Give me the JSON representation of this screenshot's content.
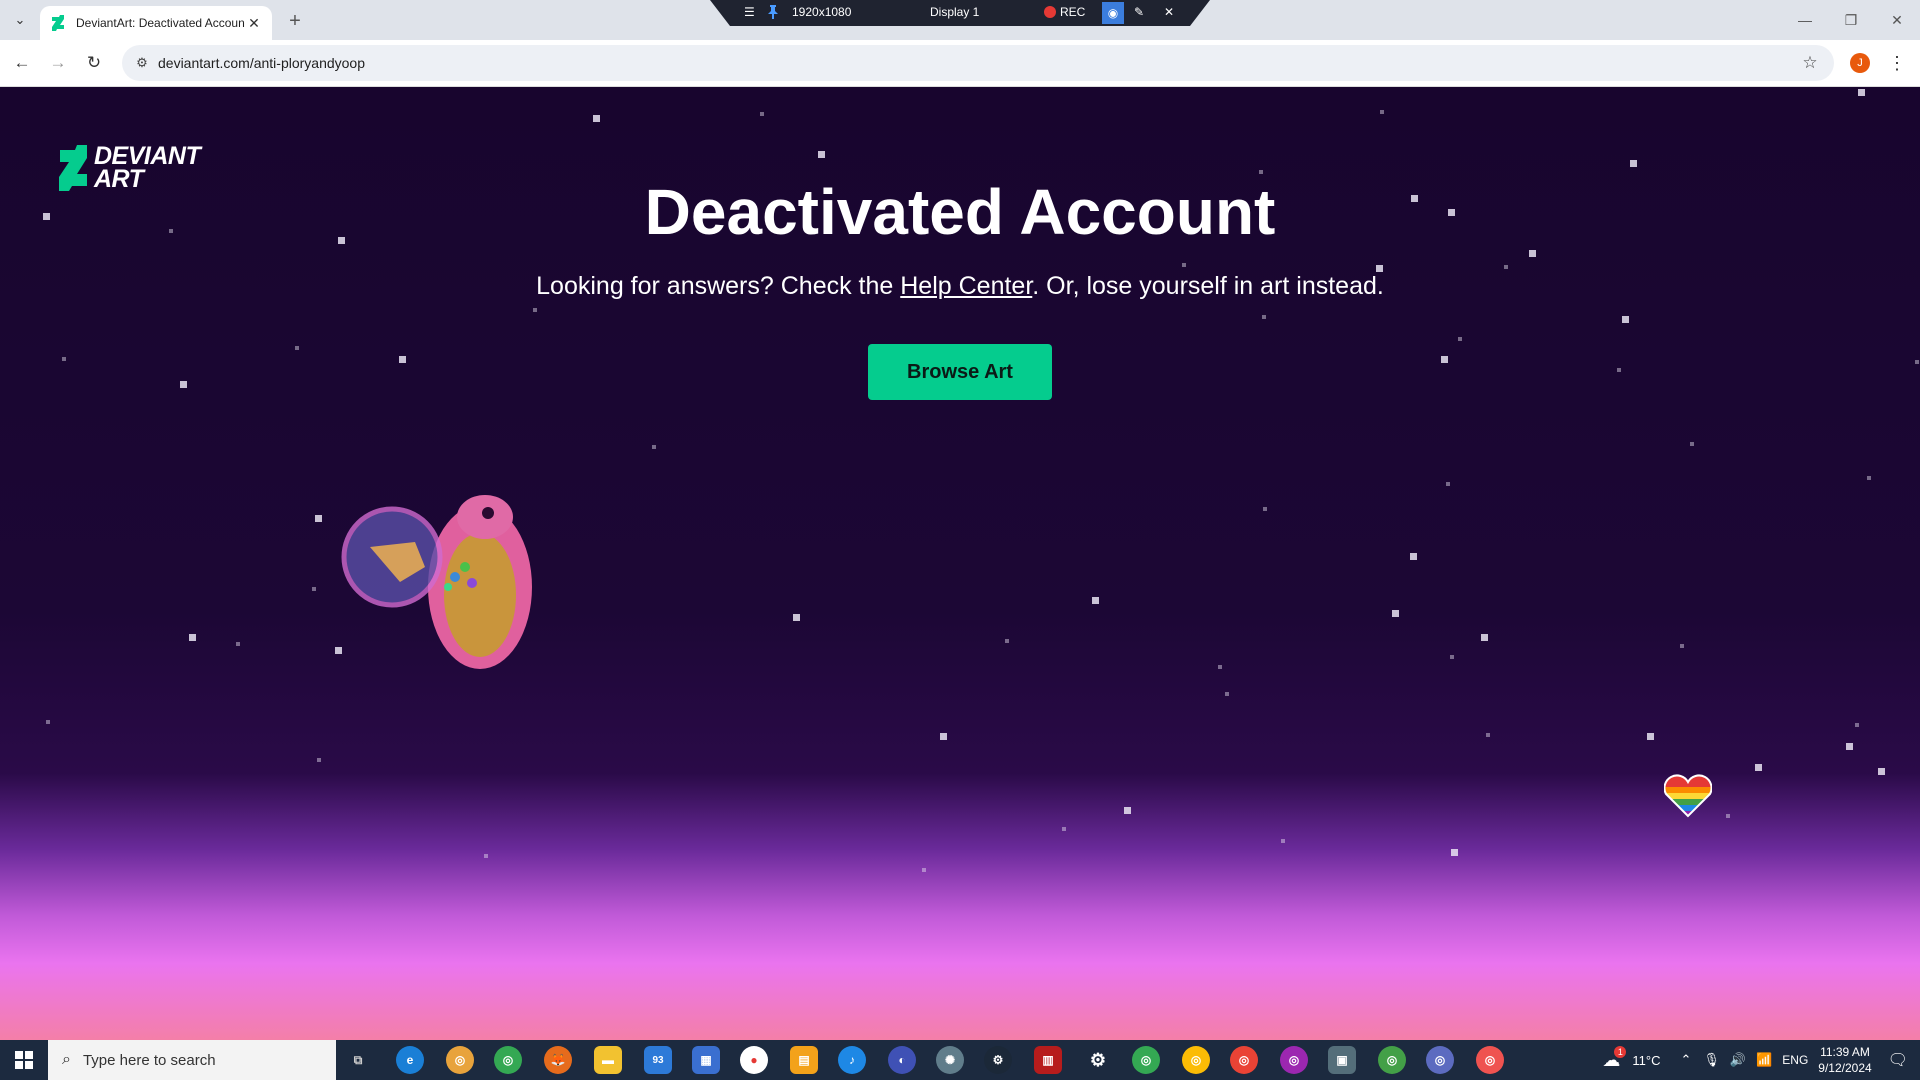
{
  "browser": {
    "tab_title": "DeviantArt: Deactivated Accoun",
    "url": "deviantart.com/anti-ploryandyoop",
    "profile_initial": "J"
  },
  "recorder": {
    "resolution": "1920x1080",
    "display": "Display 1",
    "rec_label": "REC"
  },
  "page": {
    "logo_line1": "DEVIANT",
    "logo_line2": "ART",
    "heading": "Deactivated Account",
    "sub_before": "Looking for answers? Check the ",
    "help_link": "Help Center",
    "sub_after": ". Or, lose yourself in art instead.",
    "browse_button": "Browse Art"
  },
  "taskbar": {
    "search_placeholder": "Type here to search",
    "mail_badge": "93",
    "weather": "11°C",
    "language": "ENG",
    "time": "11:39 AM",
    "date": "9/12/2024",
    "weather_badge": "1"
  },
  "colors": {
    "accent_green": "#05cc8e",
    "page_bg": "#1c0735",
    "taskbar_bg": "#1c2a3f"
  }
}
